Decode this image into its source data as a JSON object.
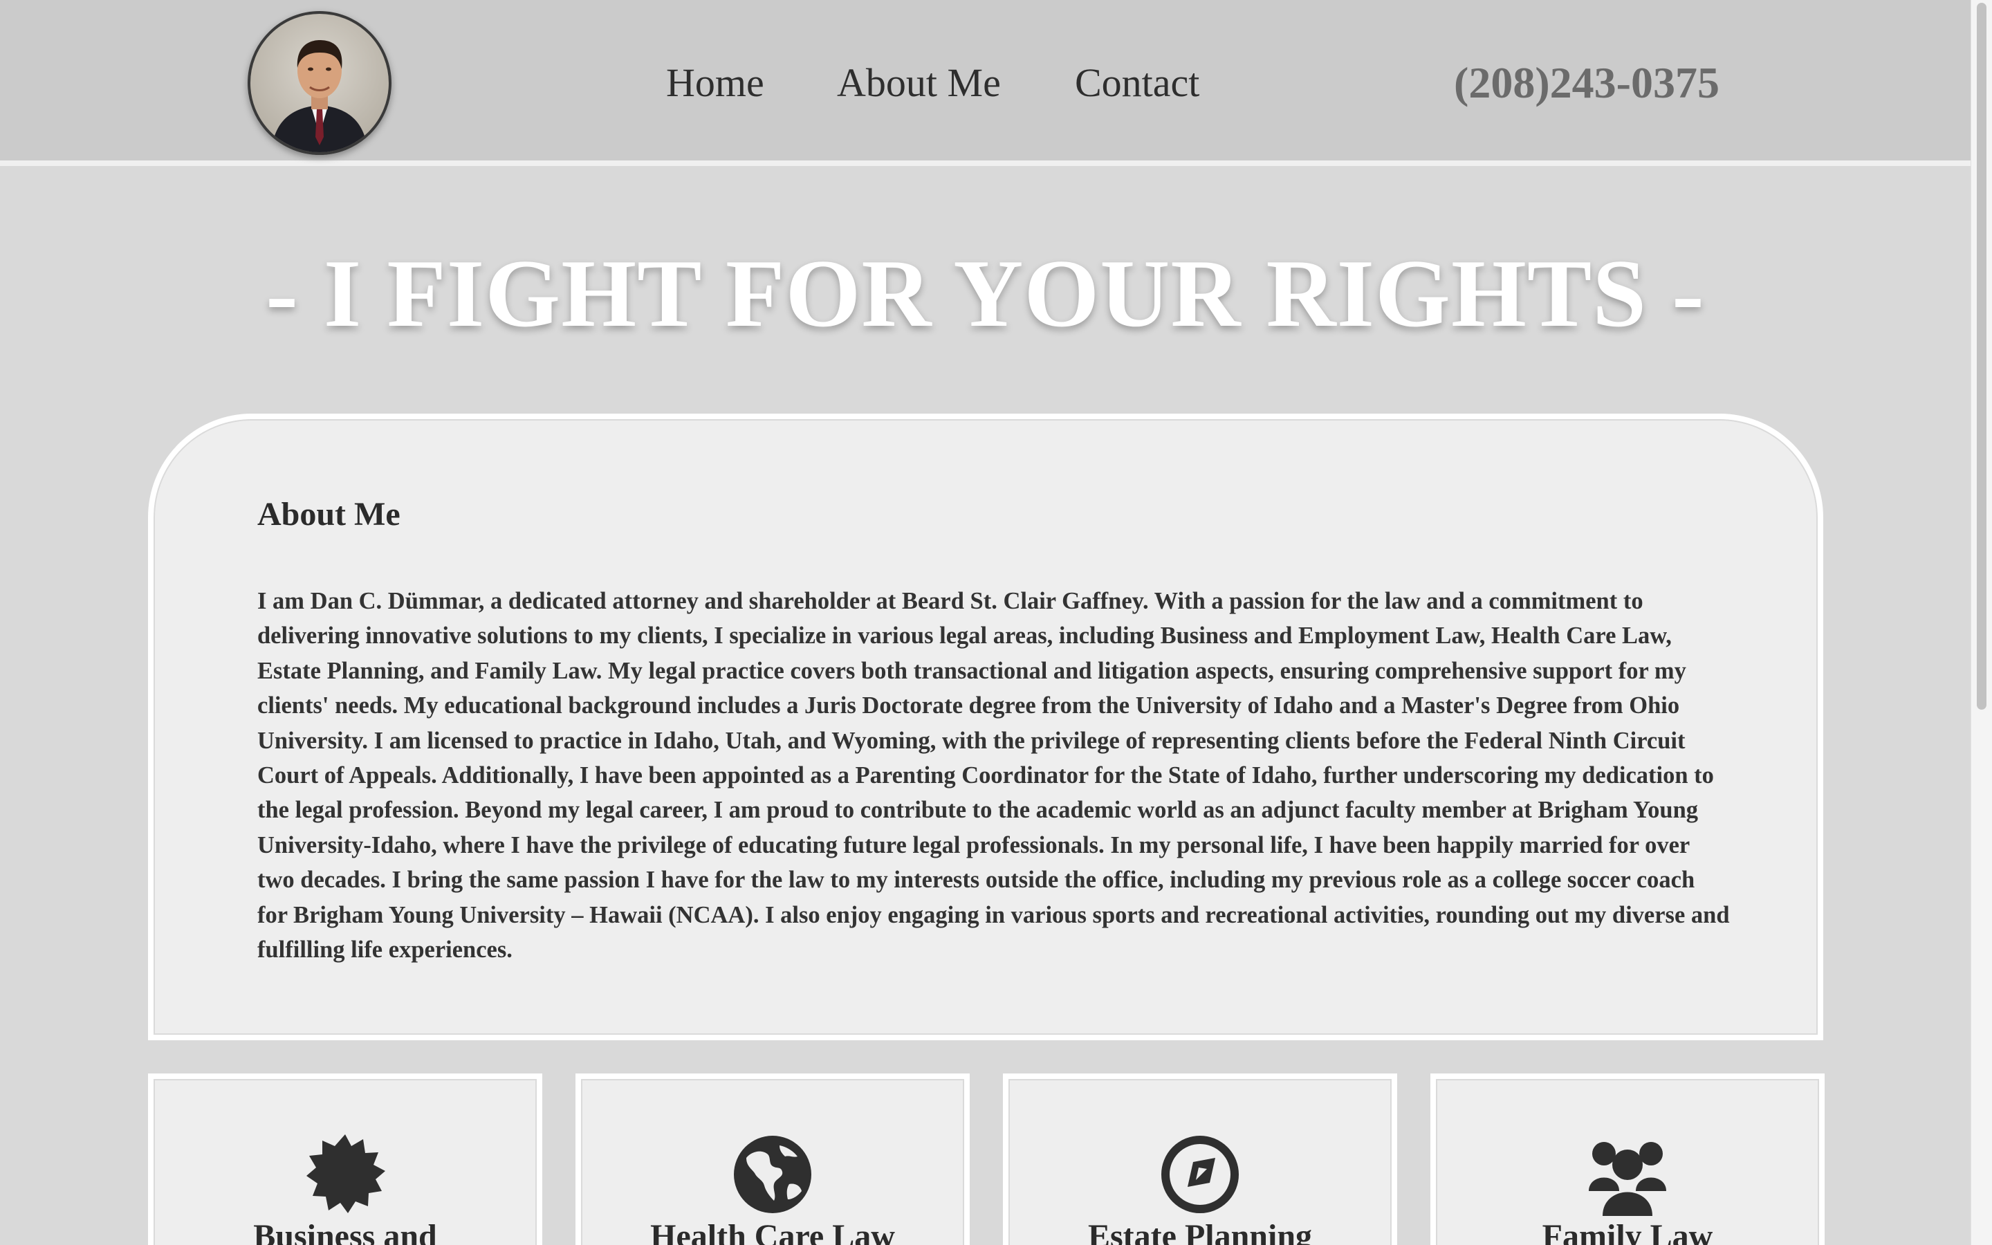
{
  "header": {
    "avatar_icon": "attorney-portrait",
    "nav": [
      "Home",
      "About Me",
      "Contact"
    ],
    "phone": "(208)243-0375"
  },
  "hero": {
    "title": "- I FIGHT FOR YOUR RIGHTS -"
  },
  "about": {
    "heading": "About Me",
    "text": "I am Dan C. Dümmar, a dedicated attorney and shareholder at Beard St. Clair Gaffney. With a passion for the law and a commitment to delivering innovative solutions to my clients, I specialize in various legal areas, including Business and Employment Law, Health Care Law, Estate Planning, and Family Law. My legal practice covers both transactional and litigation aspects, ensuring comprehensive support for my clients' needs. My educational background includes a Juris Doctorate degree from the University of Idaho and a Master's Degree from Ohio University. I am licensed to practice in Idaho, Utah, and Wyoming, with the privilege of representing clients before the Federal Ninth Circuit Court of Appeals. Additionally, I have been appointed as a Parenting Coordinator for the State of Idaho, further underscoring my dedication to the legal profession. Beyond my legal career, I am proud to contribute to the academic world as an adjunct faculty member at Brigham Young University-Idaho, where I have the privilege of educating future legal professionals. In my personal life, I have been happily married for over two decades. I bring the same passion I have for the law to my interests outside the office, including my previous role as a college soccer coach for Brigham Young University – Hawaii (NCAA). I also enjoy engaging in various sports and recreational activities, rounding out my diverse and fulfilling life experiences."
  },
  "practice_areas": [
    {
      "title": "Business and",
      "icon": "certificate-badge-icon"
    },
    {
      "title": "Health Care Law",
      "icon": "globe-americas-icon"
    },
    {
      "title": "Estate Planning",
      "icon": "compass-icon"
    },
    {
      "title": "Family Law",
      "icon": "users-group-icon"
    }
  ],
  "colors": {
    "page_bg": "#d9d9d9",
    "header_bg": "#cbcbcb",
    "card_bg": "#eeeeee",
    "card_border": "#ffffff",
    "text": "#2b2b2b",
    "phone": "#6b6b6b",
    "hero_text": "#ffffff"
  }
}
